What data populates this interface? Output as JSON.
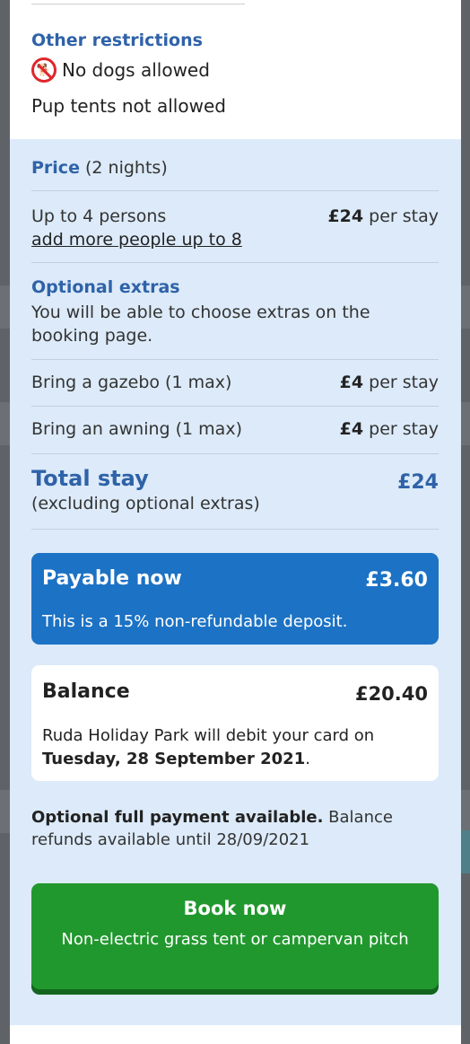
{
  "restrictions": {
    "title": "Other restrictions",
    "dogs_text": "No dogs allowed",
    "dog_icon": "no-dogs-icon",
    "pup_tents_text": "Pup tents not allowed"
  },
  "price": {
    "title_bold": "Price",
    "title_rest": " (2 nights)",
    "persons_label": "Up to 4 persons",
    "persons_price_bold": "£24",
    "persons_price_rest": " per stay",
    "add_people_link": "add more people up to 8"
  },
  "extras": {
    "title": "Optional extras",
    "description": "You will be able to choose extras on the booking page.",
    "items": [
      {
        "label": "Bring a gazebo (1 max)",
        "price": "£4",
        "unit": " per stay"
      },
      {
        "label": "Bring an awning (1 max)",
        "price": "£4",
        "unit": " per stay"
      }
    ]
  },
  "total": {
    "title": "Total stay",
    "subtitle": "(excluding optional extras)",
    "amount": "£24"
  },
  "payable": {
    "title": "Payable now",
    "amount": "£3.60",
    "description": "This is a 15% non-refundable deposit."
  },
  "balance": {
    "title": "Balance",
    "amount": "£20.40",
    "description": "Ruda Holiday Park will debit your card on ",
    "date": "Tuesday, 28 September 2021",
    "end": "."
  },
  "optional_payment": {
    "bold": "Optional full payment available.",
    "rest": " Balance refunds available until 28/09/2021"
  },
  "book_button": {
    "label": "Book now",
    "sublabel": "Non-electric grass tent or campervan pitch"
  },
  "colors": {
    "accent_blue": "#2f62a8",
    "payable_blue": "#1c72c4",
    "book_green": "#21982e",
    "panel_light": "#dceaf9"
  }
}
